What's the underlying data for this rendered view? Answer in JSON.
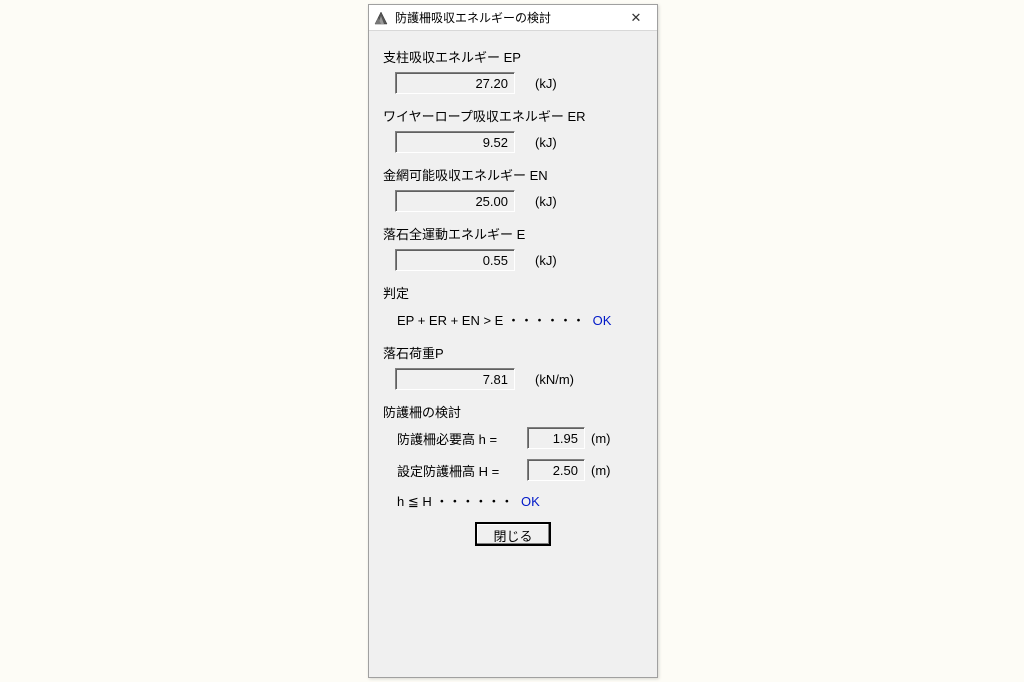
{
  "window": {
    "title": "防護柵吸収エネルギーの検討",
    "close_label": "✕"
  },
  "sections": {
    "ep": {
      "label": "支柱吸収エネルギー  EP",
      "value": "27.20",
      "unit": "(kJ)"
    },
    "er": {
      "label": "ワイヤーロープ吸収エネルギー  ER",
      "value": "9.52",
      "unit": "(kJ)"
    },
    "en": {
      "label": "金網可能吸収エネルギー  EN",
      "value": "25.00",
      "unit": "(kJ)"
    },
    "e": {
      "label": "落石全運動エネルギー  E",
      "value": "0.55",
      "unit": "(kJ)"
    }
  },
  "judgement": {
    "label": "判定",
    "formula": "EP + ER + EN > E ・・・・・・",
    "result": "OK"
  },
  "load": {
    "label": "落石荷重P",
    "value": "7.81",
    "unit": "(kN/m)"
  },
  "fence": {
    "label": "防護柵の検討",
    "required": {
      "label": "防護柵必要高   h =",
      "value": "1.95",
      "unit": "(m)"
    },
    "set": {
      "label": "設定防護柵高   H =",
      "value": "2.50",
      "unit": "(m)"
    },
    "judgement_formula": "h ≦ H ・・・・・・",
    "judgement_result": "OK"
  },
  "buttons": {
    "close": "閉じる"
  }
}
